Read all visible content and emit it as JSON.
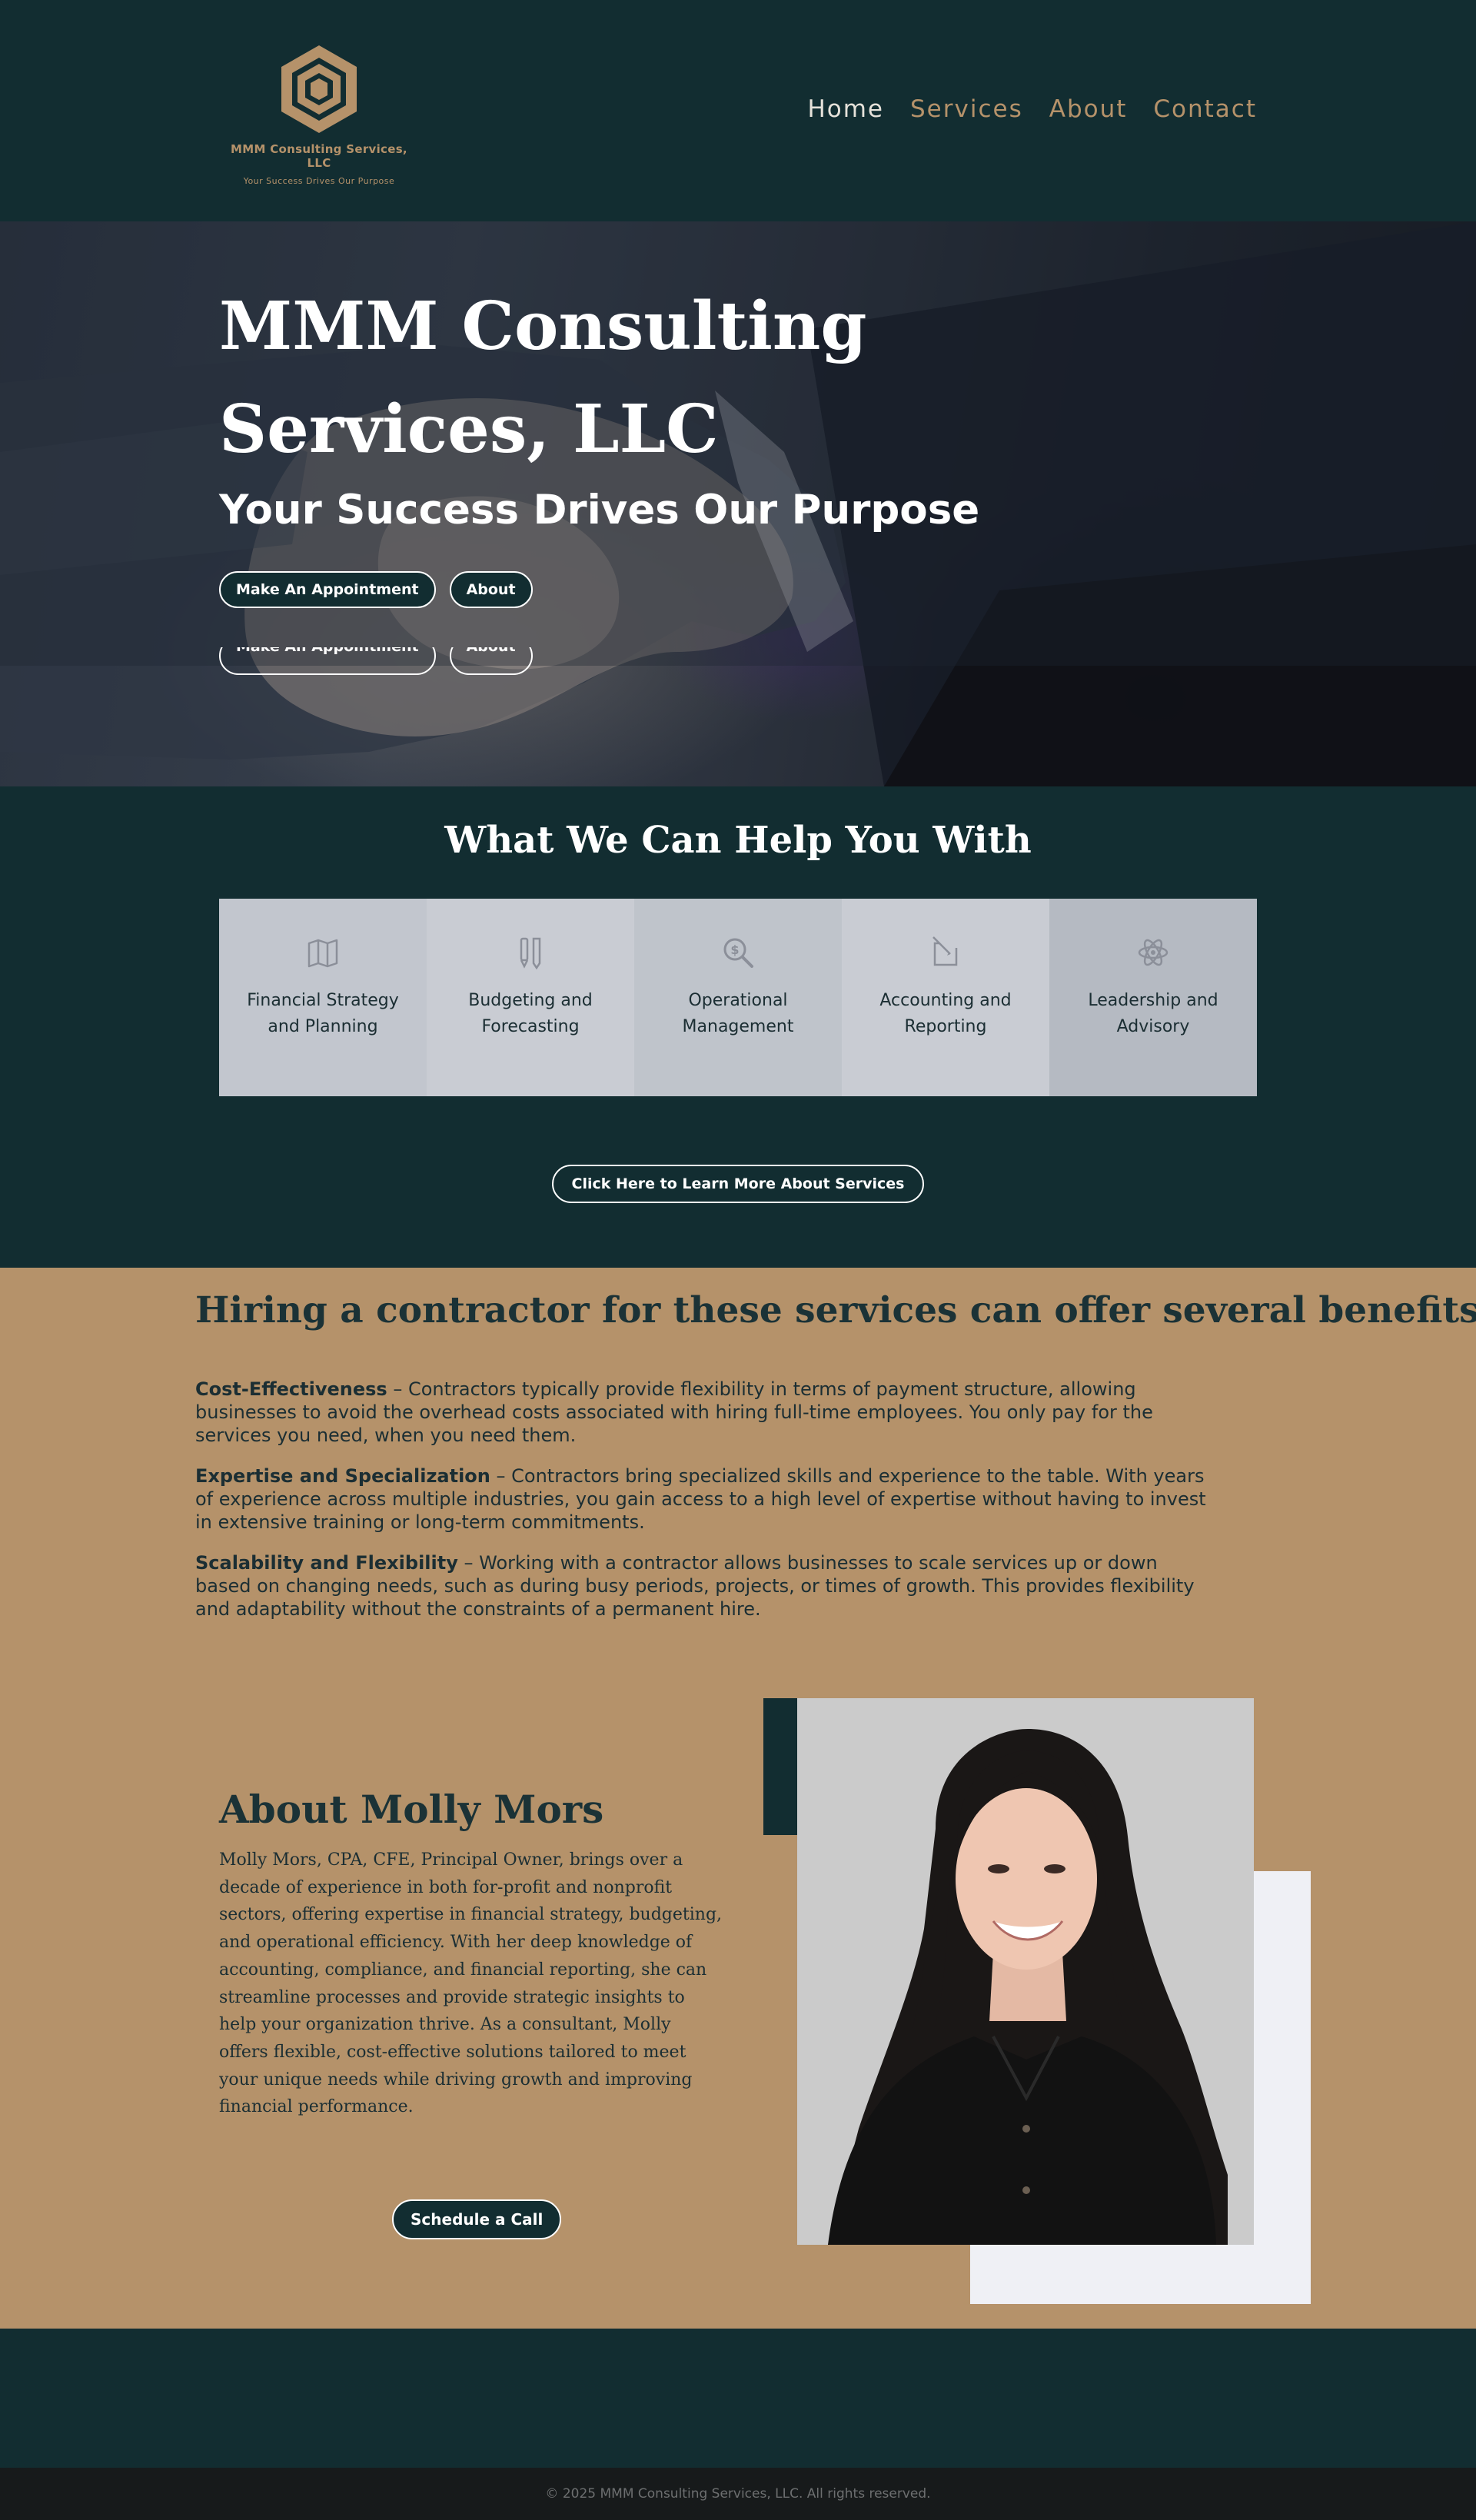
{
  "header": {
    "logo_name": "MMM Consulting Services, LLC",
    "logo_tagline": "Your Success Drives Our Purpose",
    "nav": [
      {
        "label": "Home"
      },
      {
        "label": "Services"
      },
      {
        "label": "About"
      },
      {
        "label": "Contact"
      }
    ]
  },
  "hero": {
    "title": "MMM Consulting Services, LLC",
    "subtitle": "Your Success Drives Our Purpose",
    "buttons": [
      {
        "label": "Make An Appointment"
      },
      {
        "label": "About"
      }
    ]
  },
  "services": {
    "title": "What We Can Help You With",
    "cards": [
      {
        "label": "Financial Strategy and Planning",
        "icon": "map-icon"
      },
      {
        "label": "Budgeting and Forecasting",
        "icon": "pencil-tools-icon"
      },
      {
        "label": "Operational Management",
        "icon": "magnifier-dollar-icon"
      },
      {
        "label": "Accounting and Reporting",
        "icon": "edit-document-icon"
      },
      {
        "label": "Leadership and Advisory",
        "icon": "atom-icon"
      }
    ],
    "learn_more_label": "Click Here to Learn More About Services"
  },
  "benefits": {
    "title": "Hiring a contractor for these services can offer several benefits:",
    "items": [
      {
        "heading": "Cost-Effectiveness",
        "text": " – Contractors typically provide flexibility in terms of payment structure, allowing businesses to avoid the overhead costs associated with hiring full-time employees. You only pay for the services you need, when you need them."
      },
      {
        "heading": "Expertise and Specialization",
        "text": " – Contractors bring specialized skills and experience to the table. With years of experience across multiple industries, you gain access to a high level of expertise without having to invest in extensive training or long-term commitments."
      },
      {
        "heading": "Scalability and Flexibility",
        "text": " – Working with a contractor allows businesses to scale services up or down based on changing needs, such as during busy periods, projects, or times of growth. This provides flexibility and adaptability without the constraints of a permanent hire."
      }
    ]
  },
  "about": {
    "heading": "About Molly Mors",
    "text": "Molly Mors, CPA, CFE, Principal Owner, brings over a decade of experience in both for-profit and nonprofit sectors, offering expertise in financial strategy, budgeting, and operational efficiency. With her deep knowledge of accounting, compliance, and financial reporting, she can streamline processes and provide strategic insights to help your organization thrive. As a consultant, Molly offers flexible, cost-effective solutions tailored to meet your unique needs while driving growth and improving financial performance.",
    "button_label": "Schedule a Call"
  },
  "footer": {
    "copyright": "© 2025 MMM Consulting Services, LLC. All rights reserved."
  },
  "colors": {
    "dark_teal": "#122d31",
    "gold": "#b5926a",
    "footer": "#171a1b"
  }
}
